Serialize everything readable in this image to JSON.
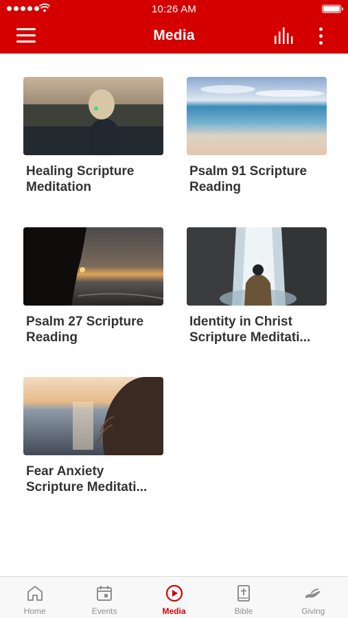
{
  "status_bar": {
    "time": "10:26 AM"
  },
  "header": {
    "title": "Media"
  },
  "media_items": [
    {
      "title": "Healing Scripture Meditation"
    },
    {
      "title": "Psalm 91 Scripture Reading"
    },
    {
      "title": "Psalm 27 Scripture Reading"
    },
    {
      "title": "Identity in Christ Scripture Meditati..."
    },
    {
      "title": "Fear Anxiety Scripture Meditati..."
    }
  ],
  "tabs": [
    {
      "label": "Home",
      "icon": "home-icon"
    },
    {
      "label": "Events",
      "icon": "calendar-icon"
    },
    {
      "label": "Media",
      "icon": "play-circle-icon",
      "active": true
    },
    {
      "label": "Bible",
      "icon": "bible-icon"
    },
    {
      "label": "Giving",
      "icon": "giving-hand-icon"
    }
  ],
  "colors": {
    "brand": "#d40000",
    "tab_inactive": "#8e8e8e",
    "text": "#333333"
  }
}
